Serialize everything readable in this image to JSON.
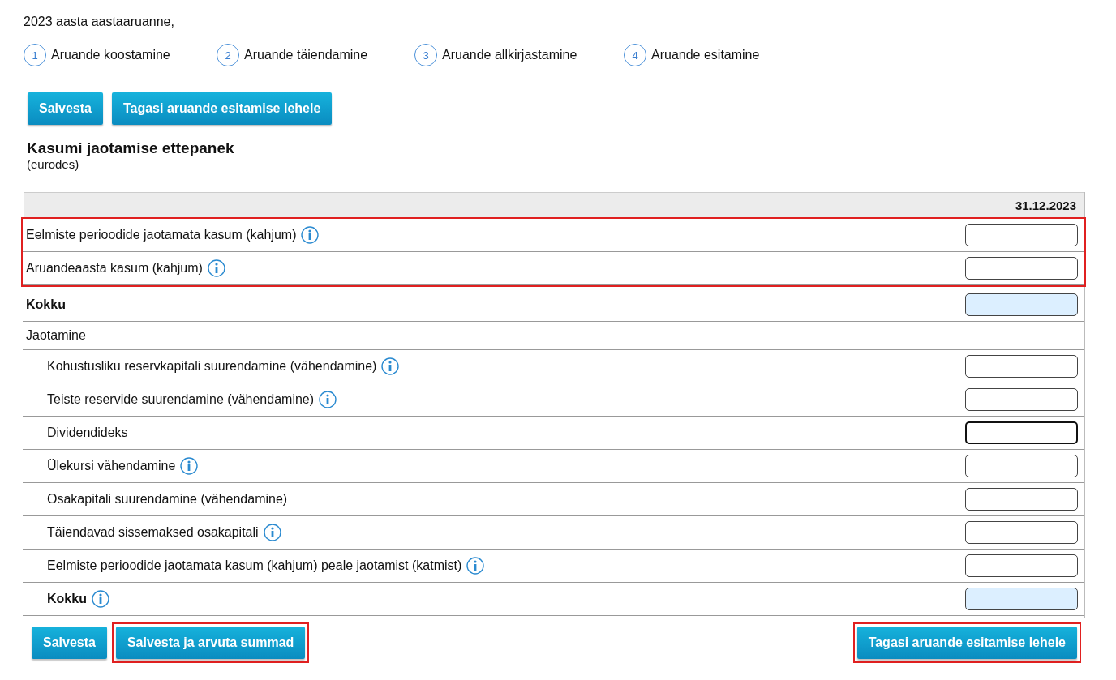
{
  "report_title": "2023 aasta aastaaruanne,",
  "steps": [
    {
      "number": "1",
      "label": "Aruande koostamine"
    },
    {
      "number": "2",
      "label": "Aruande täiendamine"
    },
    {
      "number": "3",
      "label": "Aruande allkirjastamine"
    },
    {
      "number": "4",
      "label": "Aruande esitamine"
    }
  ],
  "top_buttons": [
    {
      "label": "Salvesta",
      "highlighted": false
    },
    {
      "label": "Tagasi aruande esitamise lehele",
      "highlighted": false
    }
  ],
  "section": {
    "title": "Kasumi jaotamise ettepanek",
    "unit": "(eurodes)"
  },
  "table": {
    "columns": [
      "31.12.2023"
    ],
    "groups": [
      {
        "highlighted": true,
        "rows": [
          {
            "kind": "input",
            "label": "Eelmiste perioodide jaotamata kasum (kahjum)",
            "info": true,
            "readonly": false,
            "focused": false
          },
          {
            "kind": "input",
            "label": "Aruandeaasta kasum (kahjum)",
            "info": true,
            "readonly": false,
            "focused": false
          }
        ]
      },
      {
        "highlighted": false,
        "rows": [
          {
            "kind": "total",
            "label": "Kokku",
            "info": false,
            "readonly": true,
            "focused": false
          },
          {
            "kind": "heading",
            "label": "Jaotamine",
            "children": [
              {
                "kind": "input",
                "label": "Kohustusliku reservkapitali suurendamine (vähendamine)",
                "info": true,
                "readonly": false,
                "focused": false
              },
              {
                "kind": "input",
                "label": "Teiste reservide suurendamine (vähendamine)",
                "info": true,
                "readonly": false,
                "focused": false
              },
              {
                "kind": "input",
                "label": "Dividendideks",
                "info": false,
                "readonly": false,
                "focused": true
              },
              {
                "kind": "input",
                "label": "Ülekursi vähendamine",
                "info": true,
                "readonly": false,
                "focused": false
              },
              {
                "kind": "input",
                "label": "Osakapitali suurendamine (vähendamine)",
                "info": false,
                "readonly": false,
                "focused": false
              },
              {
                "kind": "input",
                "label": "Täiendavad sissemaksed osakapitali",
                "info": true,
                "readonly": false,
                "focused": false
              },
              {
                "kind": "input",
                "label": "Eelmiste perioodide jaotamata kasum (kahjum) peale jaotamist (katmist)",
                "info": true,
                "readonly": false,
                "focused": false
              },
              {
                "kind": "total",
                "label": "Kokku",
                "info": true,
                "readonly": true,
                "focused": false
              }
            ]
          }
        ]
      }
    ]
  },
  "bottom_buttons": {
    "left": [
      {
        "label": "Salvesta",
        "highlighted": false
      },
      {
        "label": "Salvesta ja arvuta summad",
        "highlighted": true
      }
    ],
    "right": [
      {
        "label": "Tagasi aruande esitamise lehele",
        "highlighted": true
      }
    ]
  }
}
